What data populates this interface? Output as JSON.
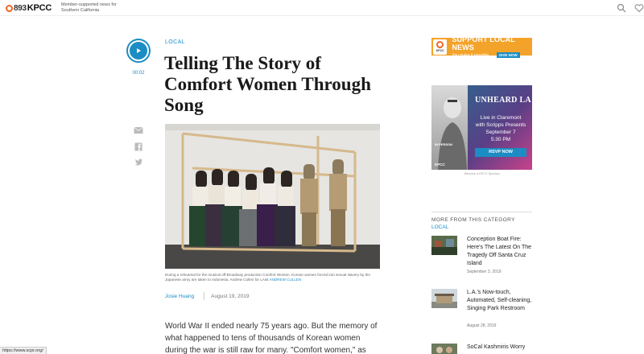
{
  "header": {
    "logo_freq": "893",
    "logo_name": "KPCC",
    "tagline": "Member-supported news for Southern California",
    "search_icon": "search-icon",
    "heart_icon": "heart-icon"
  },
  "audio": {
    "time": "00:02",
    "icon": "play-icon"
  },
  "share": [
    "email-icon",
    "facebook-icon",
    "twitter-icon"
  ],
  "article": {
    "section": "LOCAL",
    "title": "Telling The Story of Comfort Women Through Song",
    "caption_text": "During a rehearsal for the musical off-Broadway production Comfort Women. Korean women forced into sexual slavery by the Japanese army are taken to Indonesia. Andrew Cullen for LAist",
    "caption_credit": "ANDREW CULLEN",
    "author": "Josie Huang",
    "date": "August 19, 2019",
    "body": "World War II ended nearly 75 years ago. But the memory of what happened to tens of thousands of Korean women during the war is still raw for many. \"Comfort women,\" as they were euphemistically"
  },
  "status_bar": {
    "url": "https://www.scpr.org/"
  },
  "ads": {
    "support": {
      "logo_text": "KPCC",
      "headline": "SUPPORT LOCAL NEWS",
      "sub": "You make it possible.",
      "button": "GIVE NOW"
    },
    "event": {
      "title": "UNHEARD LA",
      "line1": "Live in Claremont",
      "line2": "with Scripps Presents",
      "line3": "September 7",
      "line4": "5:30 PM",
      "rsvp": "RSVP NOW",
      "in_person": "IN PERSON",
      "brand": "KPCC",
      "note": "Become a KPCC Sponsor"
    }
  },
  "more": {
    "heading": "MORE FROM THIS CATEGORY",
    "category": "LOCAL",
    "stories": [
      {
        "title": "Conception Boat Fire: Here's The Latest On The Tragedy Off Santa Cruz Island",
        "date": "September 3, 2019"
      },
      {
        "title": "L.A.'s Now-touch, Automated, Self-cleaning, Singing Park Restroom",
        "date": "August 28, 2019"
      },
      {
        "title": "SoCal Kashmiris Worry",
        "date": ""
      }
    ]
  },
  "colors": {
    "accent": "#1b8dc4",
    "brand_orange": "#f26522",
    "ad_yellow": "#f4a32a"
  }
}
